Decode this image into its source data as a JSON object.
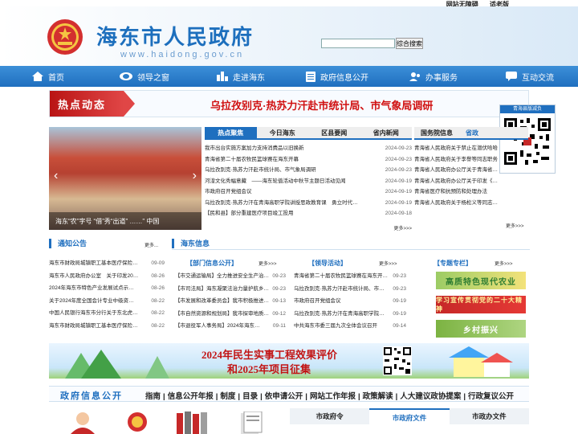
{
  "top_links": [
    "网站无障碍",
    "适老版"
  ],
  "header": {
    "title": "海东市人民政府",
    "url": "www.haidong.gov.cn"
  },
  "search": {
    "button": "综合搜索",
    "placeholder": ""
  },
  "nav": [
    {
      "label": "首页",
      "icon": "home-icon"
    },
    {
      "label": "领导之窗",
      "icon": "leader-icon"
    },
    {
      "label": "走进海东",
      "icon": "city-icon"
    },
    {
      "label": "政府信息公开",
      "icon": "document-icon"
    },
    {
      "label": "办事服务",
      "icon": "service-icon"
    },
    {
      "label": "互动交流",
      "icon": "chat-icon"
    }
  ],
  "hot": {
    "label": "热点动态",
    "headline": "乌拉孜别克·热苏力汗赴市统计局、市气象局调研"
  },
  "qr_top": {
    "title": "青海县版减负"
  },
  "slide": {
    "caption": "海东“农”字号 “借”秀“出道” ……” 中国"
  },
  "mid_tabs": [
    "热点聚焦",
    "今日海东",
    "区县要闻",
    "省内新闻"
  ],
  "mid_news": [
    {
      "t": "我市出台实施方案加力支持消费品以旧换新",
      "d": "2024-09-23"
    },
    {
      "t": "青海省第二十届农牧民篮球赛在海东开幕",
      "d": "2024-09-23"
    },
    {
      "t": "乌拉孜别克·热苏力汗赴市统计局、市气象局调研",
      "d": "2024-09-23"
    },
    {
      "t": "河湟文化秀幅意藏　——海东轮值活动中秋节主题日活动见闻",
      "d": "2024-09-19"
    },
    {
      "t": "市政府召开党组会议",
      "d": "2024-09-19"
    },
    {
      "t": "乌拉孜别克·热苏力汗在青海高职学院讲授思政教育课　勇立时代…",
      "d": "2024-09-19"
    },
    {
      "t": "【民和县】部分重建医疗项目竣工投用",
      "d": "2024-09-18"
    }
  ],
  "more": "更多>>>",
  "right_tabs": [
    "国务院信息",
    "省政"
  ],
  "right_news": [
    "青海省人民政府关于禁止在潜伏哈哈",
    "青海省人民政府关于李譽等同志职务",
    "青海省人民政府办公厅关于青海省强…",
    "青海省人民政府办公厅关于印发《青海省关于加…",
    "青海省医疗和抗预防和处理办法",
    "青海省人民政府关于杨松义等同志免职并退休的…"
  ],
  "notice": {
    "title": "通知公告",
    "items": [
      {
        "t": "海东市财政局城镇职工基本医疗保险基…",
        "d": "09-09"
      },
      {
        "t": "海东市人民政府办公室　关于印发20…",
        "d": "08-26"
      },
      {
        "t": "2024年海东市特色产业发展试点示…",
        "d": "08-26"
      },
      {
        "t": "关于2024年度全国会计专业中级资…",
        "d": "08-22"
      },
      {
        "t": "中国人民银行海东市分行关于东北虎机…",
        "d": "08-22"
      },
      {
        "t": "海东市财政局城镇职工基本医疗保险基…",
        "d": "08-22"
      }
    ]
  },
  "haidong_info": {
    "title": "海东信息",
    "dept": {
      "title": "【部门信息公开】",
      "items": [
        {
          "t": "【市交通运输局】全力推进安全生产治…",
          "d": "09-23"
        },
        {
          "t": "【市司法局】海东凝聚法治力量护航乡…",
          "d": "09-23"
        },
        {
          "t": "【市发展和改革委员会】我市积极推进…",
          "d": "09-13"
        },
        {
          "t": "【市自然资源和规划局】我市探审地质…",
          "d": "09-12"
        },
        {
          "t": "【市退役军人事务局】2024年海东…",
          "d": "09-11"
        }
      ]
    },
    "leader": {
      "title": "【领导活动】",
      "items": [
        {
          "t": "青海省第二十届农牧民篮球赛在海东开…",
          "d": "09-23"
        },
        {
          "t": "乌拉孜别克·热苏力汗赴市统计局、市…",
          "d": "09-23"
        },
        {
          "t": "市政府召开党组会议",
          "d": "09-19"
        },
        {
          "t": "乌拉孜别克·热苏力汗在青海高职学院…",
          "d": "09-19"
        },
        {
          "t": "中共海东市委三届九次全体会议召开",
          "d": "09-14"
        }
      ]
    },
    "special": {
      "title": "【专题专栏】",
      "items": [
        "高质特色现代农业",
        "学习宣传贯彻党的二十大精神",
        "乡村振兴"
      ]
    }
  },
  "big_banner": {
    "line1": "2024年民生实事工程效果评价",
    "line2": "和2025年项目征集"
  },
  "govbar": {
    "title": "政府信息公开",
    "links": [
      "指南",
      "信息公开年报",
      "制度",
      "目录",
      "依申请公开",
      "网站工作年报",
      "政策解读",
      "人大建议政协提案",
      "行政复议公开"
    ]
  },
  "bottom_tabs": [
    "市政府令",
    "市政府文件",
    "市政办文件"
  ]
}
